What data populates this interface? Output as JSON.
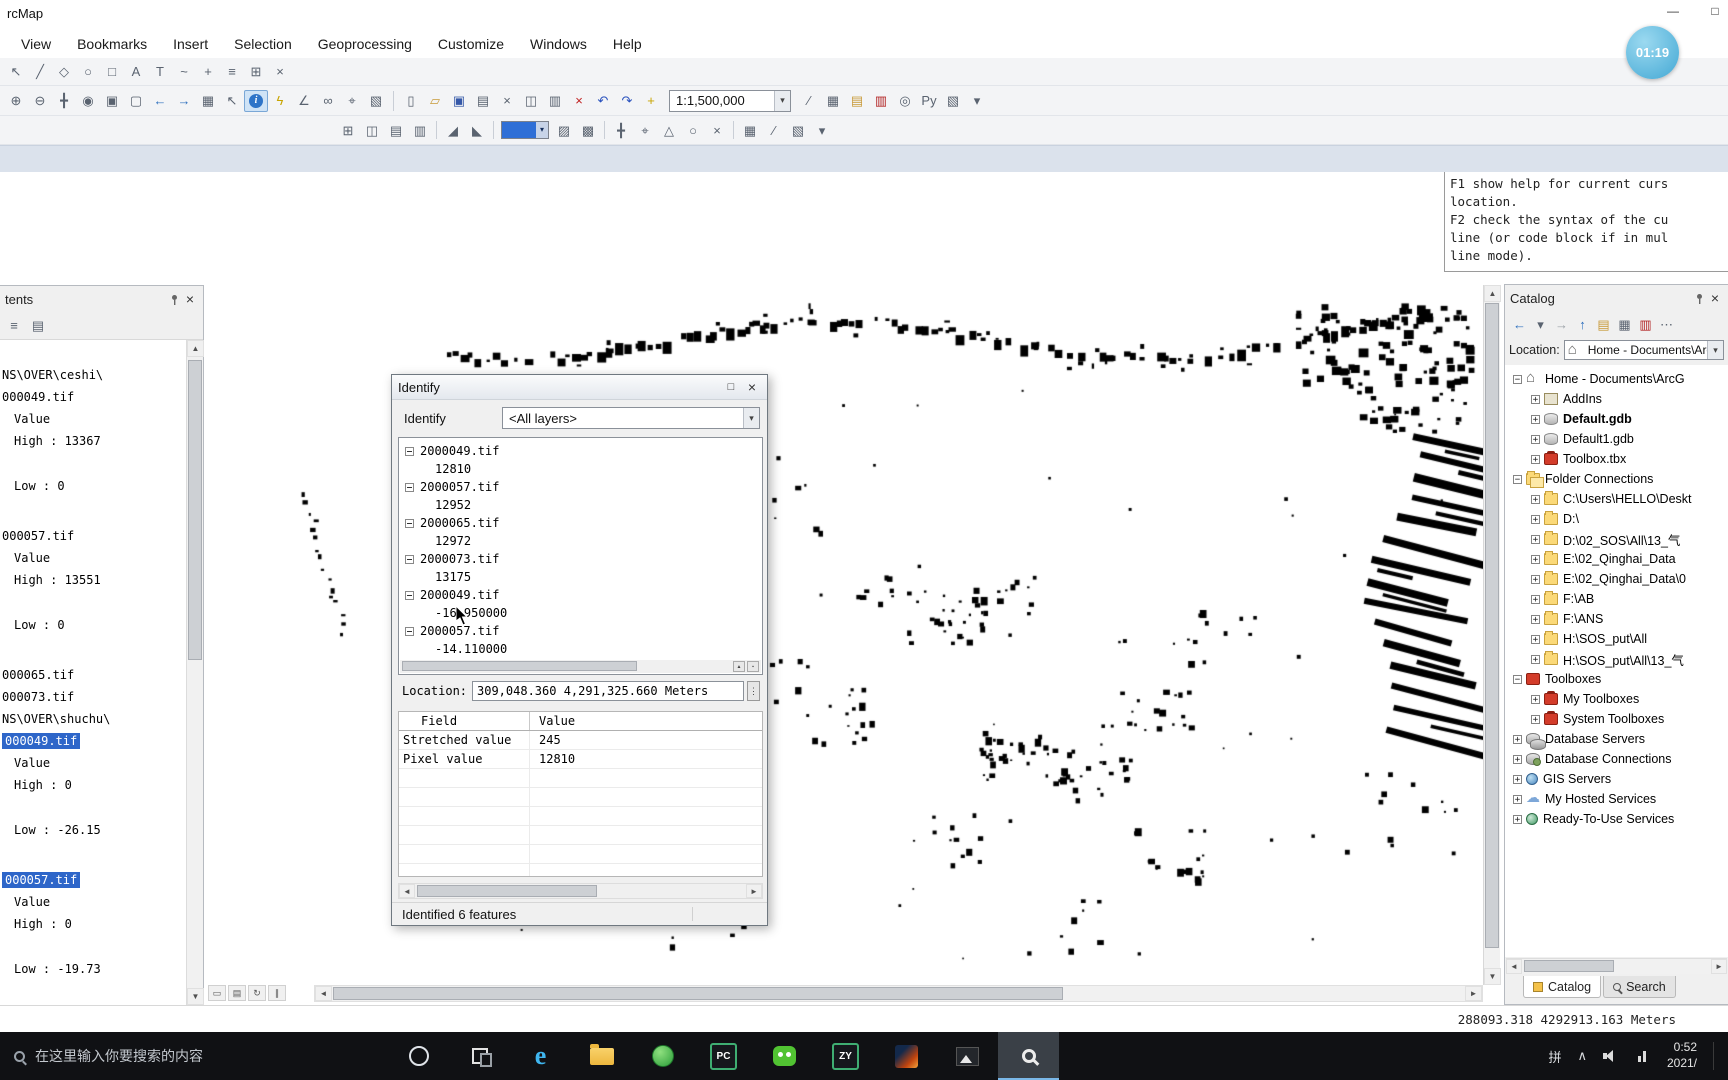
{
  "window": {
    "title": "rcMap",
    "minimize": "—",
    "maximize": "□"
  },
  "recorder": {
    "time": "01:19"
  },
  "menubar": [
    "View",
    "Bookmarks",
    "Insert",
    "Selection",
    "Geoprocessing",
    "Customize",
    "Windows",
    "Help"
  ],
  "toolbar1": [
    {
      "name": "select-elements-tool",
      "glyph": "↖"
    },
    {
      "name": "line-tool",
      "glyph": "╱"
    },
    {
      "name": "polygon-tool",
      "glyph": "◇"
    },
    {
      "name": "circle-tool",
      "glyph": "○"
    },
    {
      "name": "rectangle-tool",
      "glyph": "□"
    },
    {
      "name": "text-tool",
      "glyph": "A"
    },
    {
      "name": "label-tool",
      "glyph": "T"
    },
    {
      "name": "curve-tool",
      "glyph": "~"
    },
    {
      "name": "marker-tool",
      "glyph": "+"
    },
    {
      "name": "list-menu-tool",
      "glyph": "≡"
    },
    {
      "name": "grid-tool",
      "glyph": "⊞"
    },
    {
      "name": "clear-graphics-tool",
      "glyph": "×"
    }
  ],
  "toolbar2_tools": [
    {
      "name": "zoom-in-tool",
      "glyph": "⊕"
    },
    {
      "name": "zoom-out-tool",
      "glyph": "⊖"
    },
    {
      "name": "pan-tool",
      "glyph": "╋"
    },
    {
      "name": "full-extent-button",
      "glyph": "◉"
    },
    {
      "name": "fixed-zoom-in-button",
      "glyph": "▣"
    },
    {
      "name": "fixed-zoom-out-button",
      "glyph": "▢"
    },
    {
      "name": "back-extent-button",
      "glyph": "←",
      "color": "#2d6fbe"
    },
    {
      "name": "forward-extent-button",
      "glyph": "→",
      "color": "#2d6fbe"
    },
    {
      "name": "select-features-tool",
      "glyph": "▦"
    },
    {
      "name": "select-elements-arrow-tool",
      "glyph": "↖"
    },
    {
      "name": "identify-tool",
      "glyph": "i",
      "pressed": true
    },
    {
      "name": "hyperlink-tool",
      "glyph": "ϟ",
      "color": "#c8a400"
    },
    {
      "name": "measure-tool",
      "glyph": "∠"
    },
    {
      "name": "find-tool",
      "glyph": "∞"
    },
    {
      "name": "go-to-xy-tool",
      "glyph": "⌖"
    },
    {
      "name": "viewer-window-tool",
      "glyph": "▧"
    }
  ],
  "toolbar2_std": [
    {
      "name": "new-map-button",
      "glyph": "▯"
    },
    {
      "name": "open-map-button",
      "glyph": "▱",
      "color": "#c89a3a"
    },
    {
      "name": "save-button",
      "glyph": "▣",
      "color": "#3558a8"
    },
    {
      "name": "print-button",
      "glyph": "▤"
    },
    {
      "name": "cut-button",
      "glyph": "×"
    },
    {
      "name": "copy-button",
      "glyph": "◫"
    },
    {
      "name": "paste-button",
      "glyph": "▥"
    },
    {
      "name": "delete-button",
      "glyph": "×",
      "color": "#c02020"
    },
    {
      "name": "undo-button",
      "glyph": "↶",
      "color": "#2a52be"
    },
    {
      "name": "redo-button",
      "glyph": "↷",
      "color": "#2a52be"
    },
    {
      "name": "add-data-button",
      "glyph": "+",
      "color": "#c8a400"
    }
  ],
  "scale_combo": {
    "value": "1:1,500,000"
  },
  "toolbar2_right": [
    {
      "name": "editor-toolbar-toggle",
      "glyph": "∕"
    },
    {
      "name": "attribute-table-button",
      "glyph": "▦"
    },
    {
      "name": "catalog-window-button",
      "glyph": "▤",
      "color": "#c89a3a"
    },
    {
      "name": "arctoolbox-window-button",
      "glyph": "▥",
      "color": "#b22222"
    },
    {
      "name": "search-window-button",
      "glyph": "◎"
    },
    {
      "name": "python-window-button",
      "glyph": "Py"
    },
    {
      "name": "model-builder-button",
      "glyph": "▧"
    },
    {
      "name": "toolbar-options-dropdown",
      "glyph": "▾"
    }
  ],
  "toolbar3": [
    {
      "name": "georeferencing-tool-1",
      "glyph": "⊞"
    },
    {
      "name": "georeferencing-tool-2",
      "glyph": "◫"
    },
    {
      "name": "georeferencing-tool-3",
      "glyph": "▤"
    },
    {
      "name": "georeferencing-tool-4",
      "glyph": "▥"
    },
    {
      "name": "separator",
      "type": "sep"
    },
    {
      "name": "rotate-tool",
      "glyph": "◢"
    },
    {
      "name": "shift-tool",
      "glyph": "◣"
    },
    {
      "name": "separator",
      "type": "sep"
    },
    {
      "name": "layer-color-swatch-dropdown",
      "type": "swatch",
      "color": "#2f6fd6"
    },
    {
      "name": "raster-tool-1",
      "glyph": "▨"
    },
    {
      "name": "raster-tool-2",
      "glyph": "▩"
    },
    {
      "name": "separator",
      "type": "sep"
    },
    {
      "name": "crosshair-tool",
      "glyph": "╋"
    },
    {
      "name": "target-tool",
      "glyph": "⌖"
    },
    {
      "name": "triangle-tool",
      "glyph": "△"
    },
    {
      "name": "circle-tool-small",
      "glyph": "○"
    },
    {
      "name": "erase-tool",
      "glyph": "×"
    },
    {
      "name": "separator",
      "type": "sep"
    },
    {
      "name": "grid-display-tool",
      "glyph": "▦"
    },
    {
      "name": "draw-tool",
      "glyph": "∕"
    },
    {
      "name": "fill-tool",
      "glyph": "▧"
    },
    {
      "name": "raster-options-dropdown",
      "glyph": "▾"
    }
  ],
  "help_overlay": [
    "F1 show help for current curs",
    "location.",
    "F2 check the syntax of the cu",
    "line (or code block if in mul",
    "line mode)."
  ],
  "toc": {
    "title": "tents",
    "toolbar": [
      {
        "name": "list-by-drawing-order",
        "glyph": "≡"
      },
      {
        "name": "list-by-source",
        "glyph": "▤"
      }
    ],
    "items": [
      {
        "text": "NS\\OVER\\ceshi\\",
        "type": "path"
      },
      {
        "text": "000049.tif",
        "type": "layer"
      },
      {
        "text": "Value",
        "type": "sub"
      },
      {
        "text": "High : 13367",
        "type": "sub high"
      },
      {
        "text": "Low : 0",
        "type": "sub low"
      },
      {
        "text": "000057.tif",
        "type": "layer"
      },
      {
        "text": "Value",
        "type": "sub"
      },
      {
        "text": "High : 13551",
        "type": "sub high"
      },
      {
        "text": "Low : 0",
        "type": "sub low"
      },
      {
        "text": "000065.tif",
        "type": "layer"
      },
      {
        "text": "000073.tif",
        "type": "layer"
      },
      {
        "text": "NS\\OVER\\shuchu\\",
        "type": "path"
      },
      {
        "text": "000049.tif",
        "type": "layer sel"
      },
      {
        "text": "Value",
        "type": "sub"
      },
      {
        "text": "High : 0",
        "type": "sub high"
      },
      {
        "text": "Low : -26.15",
        "type": "sub low"
      },
      {
        "text": "000057.tif",
        "type": "layer sel"
      },
      {
        "text": "Value",
        "type": "sub"
      },
      {
        "text": "High : 0",
        "type": "sub high"
      },
      {
        "text": "Low : -19.73",
        "type": "sub low"
      }
    ]
  },
  "map_view_buttons": [
    {
      "name": "data-view-button",
      "glyph": "▭"
    },
    {
      "name": "layout-view-button",
      "glyph": "▤"
    },
    {
      "name": "refresh-view-button",
      "glyph": "↻"
    },
    {
      "name": "pause-drawing-button",
      "glyph": "∥"
    }
  ],
  "identify": {
    "title": "Identify",
    "label": "Identify",
    "layers_combo": "<All layers>",
    "tree": [
      {
        "layer": "2000049.tif",
        "value": "12810"
      },
      {
        "layer": "2000057.tif",
        "value": "12952"
      },
      {
        "layer": "2000065.tif",
        "value": "12972"
      },
      {
        "layer": "2000073.tif",
        "value": "13175"
      },
      {
        "layer": "2000049.tif",
        "value": "-16.950000"
      },
      {
        "layer": "2000057.tif",
        "value": "-14.110000"
      }
    ],
    "location_label": "Location:",
    "location_value": "309,048.360  4,291,325.660 Meters",
    "fields": {
      "headers": [
        "Field",
        "Value"
      ],
      "rows": [
        {
          "field": "Stretched value",
          "value": "245"
        },
        {
          "field": "Pixel value",
          "value": "12810"
        }
      ]
    },
    "status": "Identified 6 features"
  },
  "catalog": {
    "title": "Catalog",
    "toolbar": [
      {
        "name": "back-button",
        "glyph": "←",
        "color": "#2d6fbe"
      },
      {
        "name": "back-dropdown",
        "glyph": "▾"
      },
      {
        "name": "forward-button",
        "glyph": "→",
        "color": "#9aa0a6"
      },
      {
        "name": "up-one-level-button",
        "glyph": "↑",
        "color": "#2d6fbe"
      },
      {
        "name": "connect-folder-button",
        "glyph": "▤",
        "color": "#c89a3a"
      },
      {
        "name": "toggle-contents-button",
        "glyph": "▦"
      },
      {
        "name": "arctoolbox-button",
        "glyph": "▥",
        "color": "#b22222"
      },
      {
        "name": "options-menu-button",
        "glyph": "⋯"
      }
    ],
    "location_label": "Location:",
    "location_value": "Home - Documents\\Arc",
    "tree": [
      {
        "name": "home-folder",
        "label": "Home - Documents\\ArcG",
        "exp": "−",
        "level": 0,
        "icon": "home"
      },
      {
        "name": "addins-node",
        "label": "AddIns",
        "exp": "+",
        "level": 1,
        "icon": "addins"
      },
      {
        "name": "default-gdb",
        "label": "Default.gdb",
        "exp": "+",
        "level": 1,
        "icon": "gdb",
        "bold": true
      },
      {
        "name": "default1-gdb",
        "label": "Default1.gdb",
        "exp": "+",
        "level": 1,
        "icon": "gdb"
      },
      {
        "name": "toolbox-tbx",
        "label": "Toolbox.tbx",
        "exp": "+",
        "level": 1,
        "icon": "toolbox"
      },
      {
        "name": "folder-connections",
        "label": "Folder Connections",
        "exp": "−",
        "level": 0,
        "icon": "folders"
      },
      {
        "name": "folder-c-users",
        "label": "C:\\Users\\HELLO\\Deskt",
        "exp": "+",
        "level": 1,
        "icon": "folder"
      },
      {
        "name": "folder-d",
        "label": "D:\\",
        "exp": "+",
        "level": 1,
        "icon": "folder"
      },
      {
        "name": "folder-d-02sos",
        "label": "D:\\02_SOS\\All\\13_气",
        "exp": "+",
        "level": 1,
        "icon": "folder"
      },
      {
        "name": "folder-e-qinghai",
        "label": "E:\\02_Qinghai_Data",
        "exp": "+",
        "level": 1,
        "icon": "folder"
      },
      {
        "name": "folder-e-qinghai-02",
        "label": "E:\\02_Qinghai_Data\\0",
        "exp": "+",
        "level": 1,
        "icon": "folder"
      },
      {
        "name": "folder-f-ab",
        "label": "F:\\AB",
        "exp": "+",
        "level": 1,
        "icon": "folder"
      },
      {
        "name": "folder-f-ans",
        "label": "F:\\ANS",
        "exp": "+",
        "level": 1,
        "icon": "folder"
      },
      {
        "name": "folder-h-sos",
        "label": "H:\\SOS_put\\All",
        "exp": "+",
        "level": 1,
        "icon": "folder"
      },
      {
        "name": "folder-h-sos-13",
        "label": "H:\\SOS_put\\All\\13_气",
        "exp": "+",
        "level": 1,
        "icon": "folder"
      },
      {
        "name": "toolboxes-node",
        "label": "Toolboxes",
        "exp": "−",
        "level": 0,
        "icon": "toolboxes"
      },
      {
        "name": "my-toolboxes",
        "label": "My Toolboxes",
        "exp": "+",
        "level": 1,
        "icon": "toolbox"
      },
      {
        "name": "system-toolboxes",
        "label": "System Toolboxes",
        "exp": "+",
        "level": 1,
        "icon": "toolbox"
      },
      {
        "name": "database-servers",
        "label": "Database Servers",
        "exp": "+",
        "level": 0,
        "icon": "dbservers"
      },
      {
        "name": "database-connections",
        "label": "Database Connections",
        "exp": "+",
        "level": 0,
        "icon": "dbconn"
      },
      {
        "name": "gis-servers",
        "label": "GIS Servers",
        "exp": "+",
        "level": 0,
        "icon": "gis"
      },
      {
        "name": "my-hosted-services",
        "label": "My Hosted Services",
        "exp": "+",
        "level": 0,
        "icon": "cloud"
      },
      {
        "name": "ready-to-use-services",
        "label": "Ready-To-Use Services",
        "exp": "+",
        "level": 0,
        "icon": "ready"
      }
    ],
    "tabs": [
      {
        "name": "catalog-tab",
        "label": "Catalog",
        "icon": "cabinet",
        "active": true
      },
      {
        "name": "search-tab",
        "label": "Search",
        "icon": "search",
        "active": false
      }
    ]
  },
  "status_bar": {
    "coordinates": "288093.318 4292913.163 Meters"
  },
  "taskbar": {
    "search_text": "在这里输入你要搜索的内容",
    "apps": [
      {
        "name": "cortana-button",
        "kind": "cortana"
      },
      {
        "name": "task-view-button",
        "kind": "taskview"
      },
      {
        "name": "edge-app",
        "kind": "edge",
        "label": "e"
      },
      {
        "name": "file-explorer-app",
        "kind": "folder"
      },
      {
        "name": "browser-360-app",
        "kind": "greenball"
      },
      {
        "name": "pycharm-app",
        "kind": "badge",
        "label": "PC"
      },
      {
        "name": "wechat-app",
        "kind": "wechat"
      },
      {
        "name": "zy-app",
        "kind": "badge",
        "label": "ZY"
      },
      {
        "name": "matlab-app",
        "kind": "matlab"
      },
      {
        "name": "photos-app",
        "kind": "photos"
      },
      {
        "name": "magnifier-app",
        "kind": "magnifier",
        "active": true
      }
    ],
    "tray_ime": "拼",
    "tray_chevron": "∧",
    "clock_time": "0:52",
    "clock_date": "2021/"
  }
}
